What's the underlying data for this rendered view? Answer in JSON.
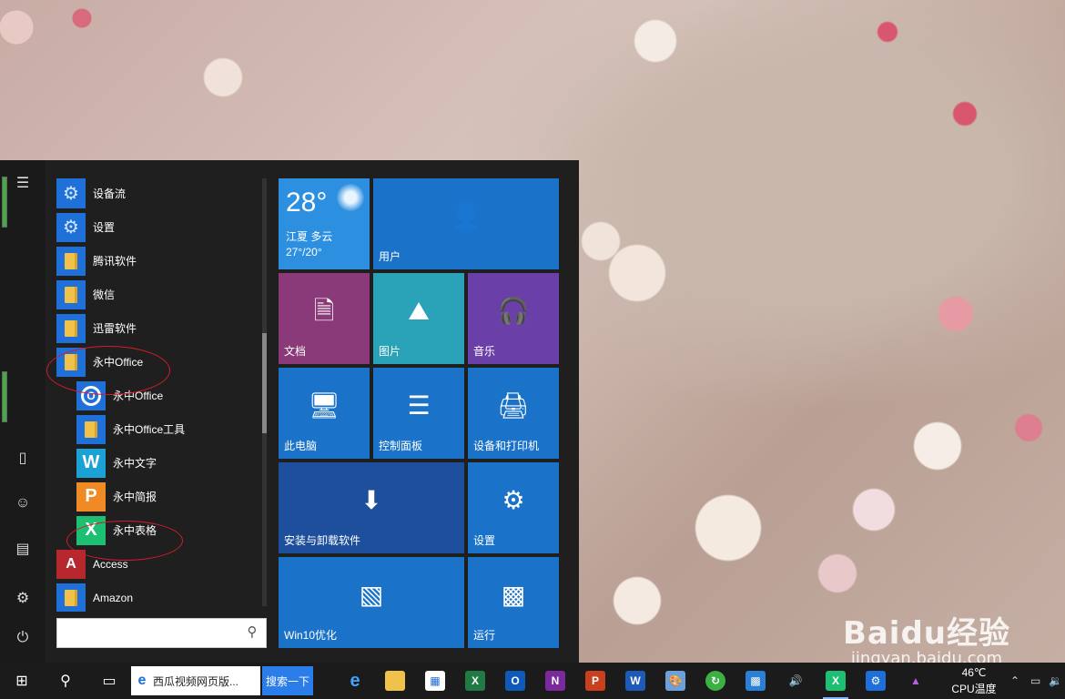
{
  "start_menu": {
    "apps": [
      {
        "label": "设备流",
        "icon": "gear-icon",
        "color": "#1f70d8"
      },
      {
        "label": "设置",
        "icon": "gear-icon",
        "color": "#1f70d8"
      },
      {
        "label": "腾讯软件",
        "icon": "folder-icon",
        "color": "#1f70d8"
      },
      {
        "label": "微信",
        "icon": "folder-icon",
        "color": "#1f70d8"
      },
      {
        "label": "迅雷软件",
        "icon": "folder-icon",
        "color": "#1f70d8"
      },
      {
        "label": "永中Office",
        "icon": "folder-icon",
        "color": "#1f70d8"
      },
      {
        "label": "永中Office",
        "icon": "yozo-office-icon",
        "color": "#1f70d8",
        "glyph": "O"
      },
      {
        "label": "永中Office工具",
        "icon": "folder-icon",
        "color": "#1f70d8"
      },
      {
        "label": "永中文字",
        "icon": "yozo-writer-icon",
        "color": "#1aa1d6",
        "glyph": "W"
      },
      {
        "label": "永中简报",
        "icon": "yozo-presentation-icon",
        "color": "#f08a24",
        "glyph": "P"
      },
      {
        "label": "永中表格",
        "icon": "yozo-spreadsheet-icon",
        "color": "#1dbf73",
        "glyph": "X"
      },
      {
        "label": "Access",
        "icon": "access-icon",
        "color": "#b7282e",
        "glyph": "A"
      },
      {
        "label": "Amazon",
        "icon": "folder-icon",
        "color": "#1f70d8"
      }
    ],
    "search_placeholder": ""
  },
  "tiles": {
    "weather": {
      "temp": "28°",
      "city": "江夏 多云",
      "range": "27°/20°"
    },
    "user": {
      "label": "用户",
      "icon": "user-icon"
    },
    "documents": {
      "label": "文档",
      "icon": "document-icon",
      "color": "#8a3a78"
    },
    "pictures": {
      "label": "图片",
      "icon": "picture-icon",
      "color": "#2aa3b8"
    },
    "music": {
      "label": "音乐",
      "icon": "headphones-icon",
      "color": "#6b3fa8"
    },
    "this_pc": {
      "label": "此电脑",
      "icon": "monitor-icon"
    },
    "control_panel": {
      "label": "控制面板",
      "icon": "sliders-icon"
    },
    "devices_printers": {
      "label": "设备和打印机",
      "icon": "printer-icon"
    },
    "install_uninstall": {
      "label": "安装与卸载软件",
      "icon": "install-icon",
      "color": "#1e4f9c"
    },
    "settings": {
      "label": "设置",
      "icon": "gear-icon"
    },
    "win10": {
      "label": "Win10优化",
      "icon": "win10-optimize-icon"
    },
    "run": {
      "label": "运行",
      "icon": "run-icon"
    }
  },
  "taskbar": {
    "ie_task_label": "西瓜视频网页版...",
    "search_button": "搜索一下",
    "cpu_temp": "46℃",
    "cpu_label": "CPU温度"
  },
  "watermark": {
    "logo": "Baidu经验",
    "url": "jingyan.baidu.com"
  }
}
